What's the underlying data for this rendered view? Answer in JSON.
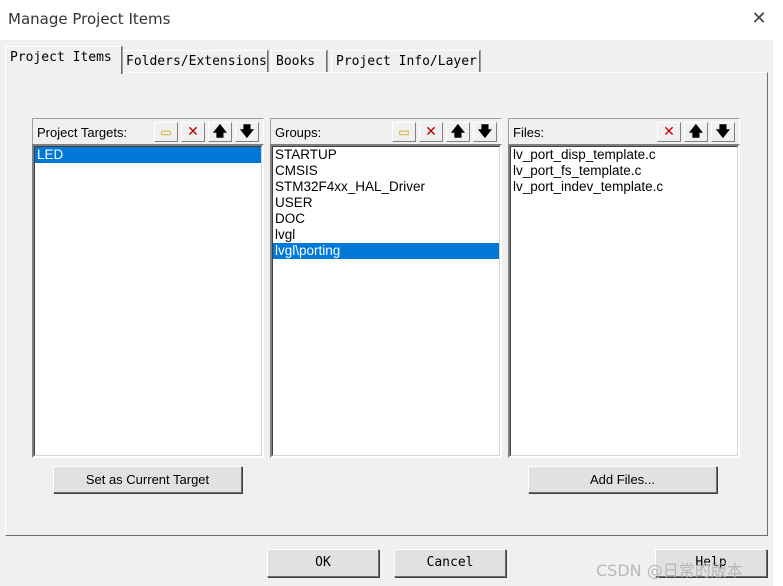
{
  "window": {
    "title": "Manage Project Items",
    "close_glyph": "✕"
  },
  "tabs": [
    {
      "label": "Project Items",
      "active": true
    },
    {
      "label": "Folders/Extensions",
      "active": false
    },
    {
      "label": "Books",
      "active": false
    },
    {
      "label": "Project Info/Layer",
      "active": false
    }
  ],
  "targets": {
    "label": "Project Targets:",
    "items": [
      "LED"
    ],
    "selected": "LED",
    "button": "Set as Current Target"
  },
  "groups": {
    "label": "Groups:",
    "items": [
      "STARTUP",
      "CMSIS",
      "STM32F4xx_HAL_Driver",
      "USER",
      "DOC",
      "lvgl",
      "lvgl\\porting"
    ],
    "selected": "lvgl\\porting"
  },
  "files": {
    "label": "Files:",
    "items": [
      "lv_port_disp_template.c",
      "lv_port_fs_template.c",
      "lv_port_indev_template.c"
    ],
    "button": "Add Files..."
  },
  "toolbar_icons": {
    "new": "new-item-icon",
    "delete": "delete-icon",
    "up": "move-up-icon",
    "down": "move-down-icon"
  },
  "glyphs": {
    "new": "▭",
    "delete": "✕",
    "up": "🡅",
    "down": "🡇"
  },
  "footer": {
    "ok": "OK",
    "cancel": "Cancel",
    "help": "Help"
  },
  "watermark": "CSDN @日常的版本",
  "colors": {
    "selection": "#0078d7",
    "delete": "#c00000"
  }
}
